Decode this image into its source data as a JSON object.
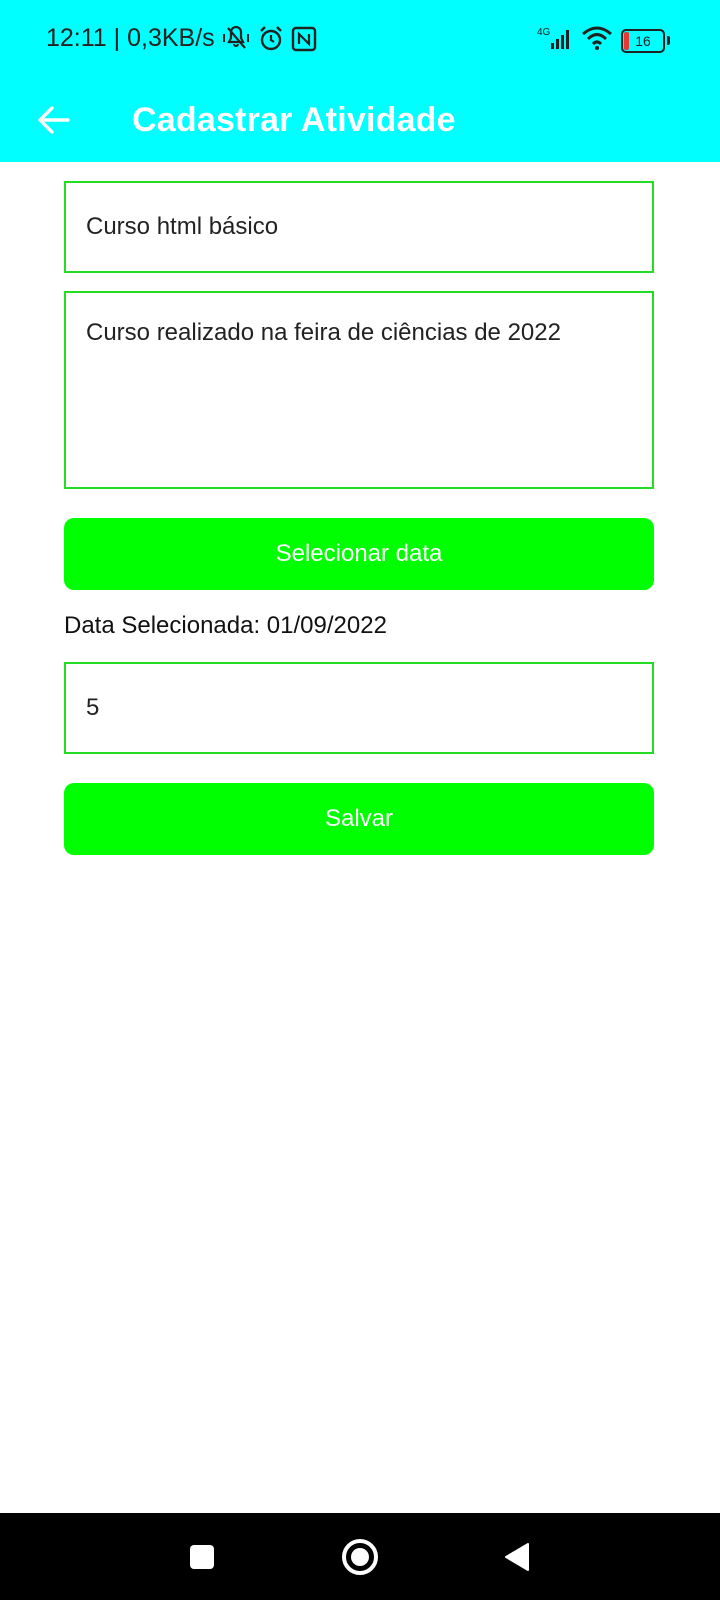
{
  "status_bar": {
    "time_speed": "12:11 | 0,3KB/s",
    "network_label": "4G",
    "battery_level": "16",
    "icons": [
      "mute-vibrate-icon",
      "alarm-icon",
      "nfc-icon",
      "signal-icon",
      "wifi-icon",
      "battery-icon"
    ]
  },
  "app_bar": {
    "title": "Cadastrar Atividade",
    "background_color": "#00ffff"
  },
  "form": {
    "title_value": "Curso html básico",
    "description_value": "Curso realizado na feira de ciências de 2022",
    "select_date_label": "Selecionar data",
    "selected_date_text": "Data Selecionada: 01/09/2022",
    "hours_value": "5",
    "save_label": "Salvar",
    "accent_color": "#00ff00",
    "field_border_color": "#22dd22"
  },
  "nav_bar": {
    "buttons": [
      "recents-icon",
      "home-icon",
      "back-icon"
    ]
  }
}
